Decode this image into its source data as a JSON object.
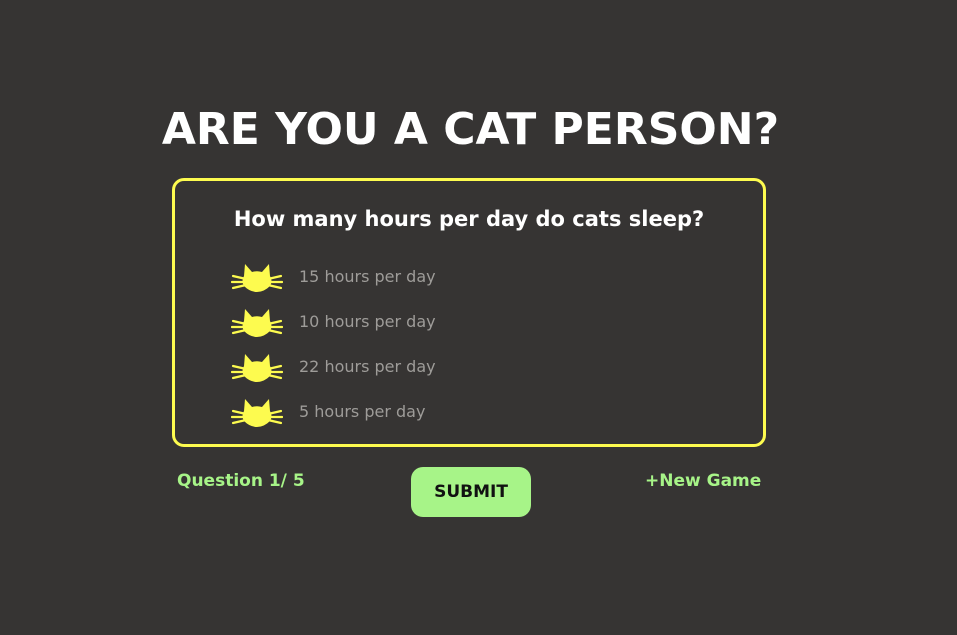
{
  "page": {
    "title": "ARE YOU A CAT PERSON?"
  },
  "quiz": {
    "question": "How many hours per day do cats sleep?",
    "options": [
      {
        "label": "15 hours per day",
        "icon": "cat-face-icon"
      },
      {
        "label": "10 hours per day",
        "icon": "cat-face-icon"
      },
      {
        "label": "22 hours per day",
        "icon": "cat-face-icon"
      },
      {
        "label": "5 hours per day",
        "icon": "cat-face-icon"
      }
    ]
  },
  "footer": {
    "progress": "Question 1/ 5",
    "submit_label": "SUBMIT",
    "new_game_label": "+New Game"
  },
  "colors": {
    "background": "#363433",
    "accent_yellow": "#fdfb4f",
    "accent_green": "#a7f488",
    "option_text": "#9e9c99",
    "heading_text": "#ffffff"
  }
}
